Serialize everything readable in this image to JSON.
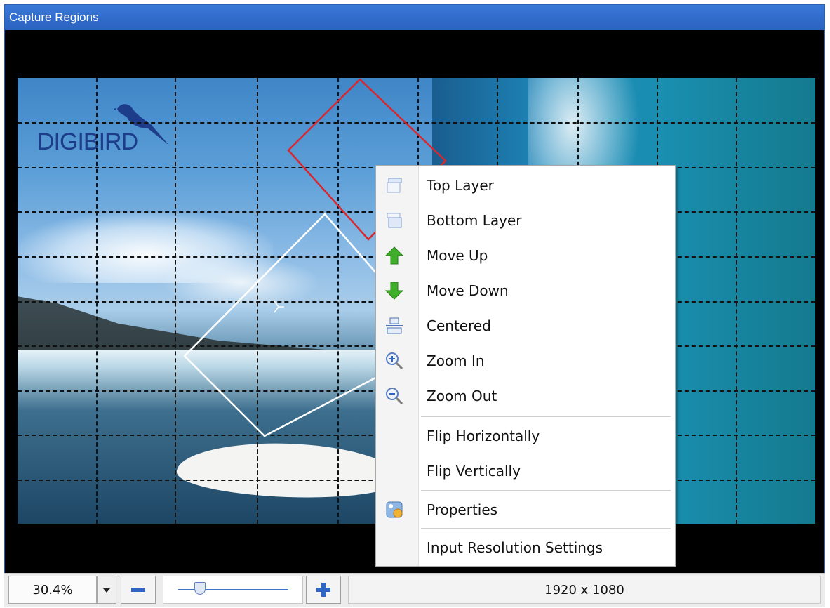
{
  "window": {
    "title": "Capture Regions"
  },
  "canvas": {
    "logo_text": "DIGIBIRD"
  },
  "context_menu": {
    "items": [
      {
        "label": "Top Layer",
        "icon": "layer-top-icon"
      },
      {
        "label": "Bottom Layer",
        "icon": "layer-bottom-icon"
      },
      {
        "label": "Move Up",
        "icon": "arrow-up-green-icon"
      },
      {
        "label": "Move Down",
        "icon": "arrow-down-green-icon"
      },
      {
        "label": "Centered",
        "icon": "center-align-icon"
      },
      {
        "label": "Zoom In",
        "icon": "zoom-in-icon"
      },
      {
        "label": "Zoom Out",
        "icon": "zoom-out-icon"
      },
      {
        "label": "Flip Horizontally",
        "icon": ""
      },
      {
        "label": "Flip Vertically",
        "icon": ""
      },
      {
        "label": "Properties",
        "icon": "properties-icon"
      },
      {
        "label": "Input Resolution Settings",
        "icon": ""
      }
    ]
  },
  "toolbar": {
    "zoom_value": "30.4%",
    "zoom_slider_level": 0.2,
    "resolution": "1920 x 1080"
  },
  "colors": {
    "title_bar": "#2a62c0",
    "region_red": "#d8272e",
    "region_white": "#ffffff",
    "move_arrow_green": "#3fae2a",
    "zoom_button_blue": "#2f66c3"
  }
}
